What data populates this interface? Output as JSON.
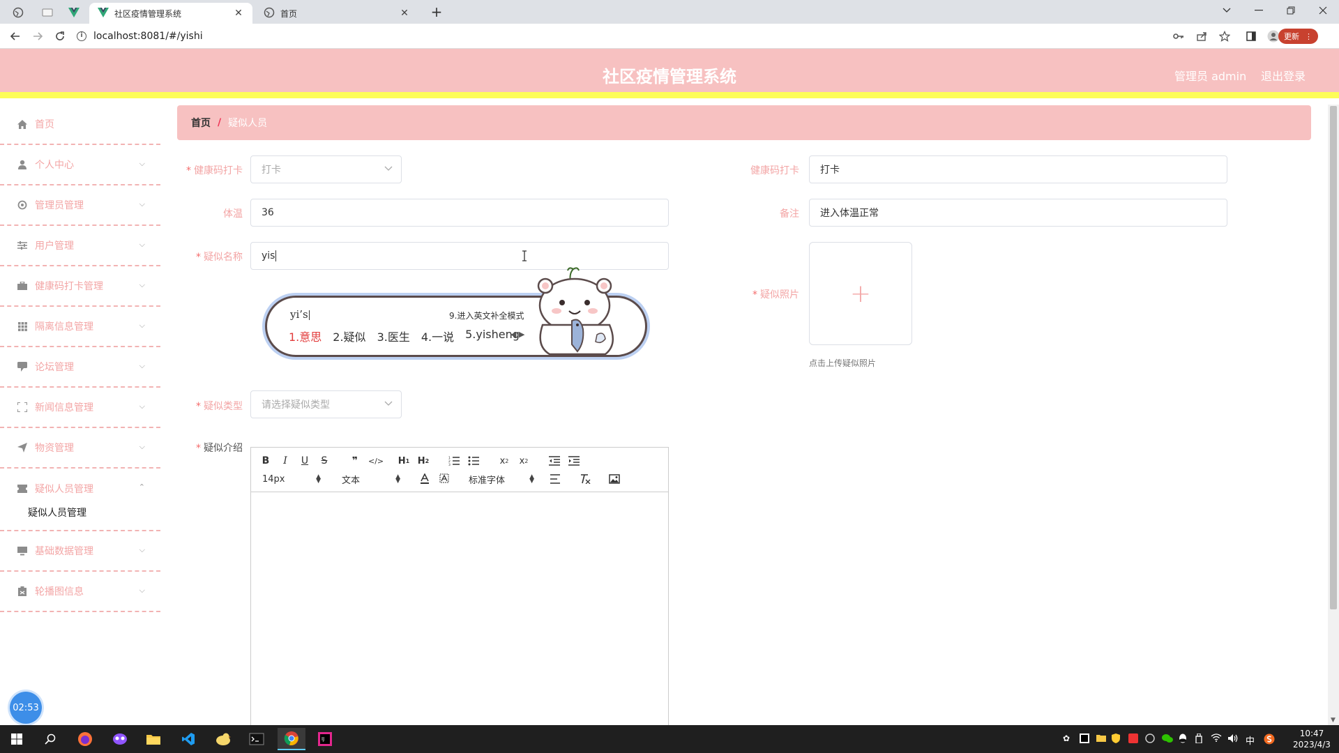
{
  "browser": {
    "tabs": [
      {
        "title": "社区疫情管理系统"
      },
      {
        "title": "首页"
      }
    ],
    "url": "localhost:8081/#/yishi",
    "update_label": "更新"
  },
  "app": {
    "title": "社区疫情管理系统",
    "user_label": "管理员 admin",
    "logout_label": "退出登录"
  },
  "sidebar": {
    "items": [
      {
        "label": "首页",
        "icon": "home-icon"
      },
      {
        "label": "个人中心",
        "icon": "user-icon"
      },
      {
        "label": "管理员管理",
        "icon": "gear-icon"
      },
      {
        "label": "用户管理",
        "icon": "sliders-icon"
      },
      {
        "label": "健康码打卡管理",
        "icon": "briefcase-icon"
      },
      {
        "label": "隔离信息管理",
        "icon": "grid-icon"
      },
      {
        "label": "论坛管理",
        "icon": "chat-icon"
      },
      {
        "label": "新闻信息管理",
        "icon": "fullscreen-icon"
      },
      {
        "label": "物资管理",
        "icon": "send-icon"
      },
      {
        "label": "疑似人员管理",
        "icon": "ticket-icon"
      },
      {
        "label": "基础数据管理",
        "icon": "monitor-icon"
      },
      {
        "label": "轮播图信息",
        "icon": "clipboard-icon"
      }
    ],
    "submenu": {
      "label": "疑似人员管理"
    },
    "timer": "02:53"
  },
  "breadcrumb": {
    "home": "首页",
    "separator": "/",
    "current": "疑似人员"
  },
  "form": {
    "checkin_select": {
      "label": "健康码打卡",
      "value": "打卡"
    },
    "checkin_text": {
      "label": "健康码打卡",
      "value": "打卡"
    },
    "temperature": {
      "label": "体温",
      "value": "36"
    },
    "remark": {
      "label": "备注",
      "value": "进入体温正常"
    },
    "name": {
      "label": "疑似名称",
      "value": "yis"
    },
    "photo": {
      "label": "疑似照片",
      "tip": "点击上传疑似照片",
      "plus": "+"
    },
    "type": {
      "label": "疑似类型",
      "placeholder": "请选择疑似类型"
    },
    "intro": {
      "label": "疑似介绍"
    }
  },
  "ime": {
    "composition": "yi’s",
    "hint": "9.进入英文补全模式",
    "candidates": [
      "1.意思",
      "2.疑似",
      "3.医生",
      "4.一说",
      "5.yisheng"
    ]
  },
  "editor": {
    "font_size": "14px",
    "format": "文本",
    "font_family": "标准字体"
  },
  "taskbar": {
    "ime_lang": "中",
    "time": "10:47",
    "date": "2023/4/3"
  },
  "colors": {
    "header_bg": "#f7c1c1",
    "accent_line": "#fdfd57",
    "menu_text": "#f3a5a5",
    "required": "#f56c6c"
  }
}
